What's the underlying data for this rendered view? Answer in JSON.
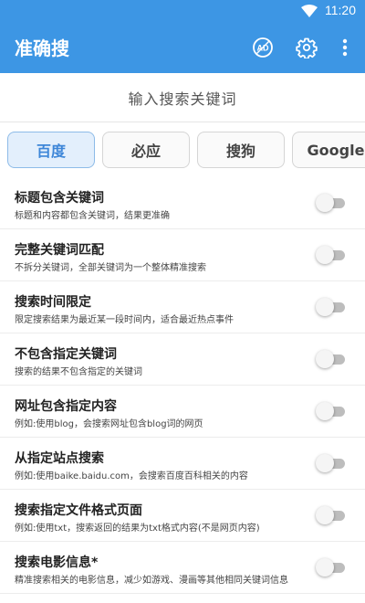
{
  "status_bar": {
    "time": "11:20"
  },
  "app_bar": {
    "title": "准确搜",
    "ad_label": "AD"
  },
  "search": {
    "placeholder": "输入搜索关键词"
  },
  "engines": [
    {
      "label": "百度",
      "active": true
    },
    {
      "label": "必应",
      "active": false
    },
    {
      "label": "搜狗",
      "active": false
    },
    {
      "label": "Google",
      "active": false
    }
  ],
  "options": [
    {
      "title": "标题包含关键词",
      "desc": "标题和内容都包含关键词，结果更准确",
      "enabled": false
    },
    {
      "title": "完整关键词匹配",
      "desc": "不拆分关键词，全部关键词为一个整体精准搜索",
      "enabled": false
    },
    {
      "title": "搜索时间限定",
      "desc": "限定搜索结果为最近某一段时间内，适合最近热点事件",
      "enabled": false
    },
    {
      "title": "不包含指定关键词",
      "desc": "搜索的结果不包含指定的关键词",
      "enabled": false
    },
    {
      "title": "网址包含指定内容",
      "desc": "例如:使用blog，会搜索网址包含blog词的网页",
      "enabled": false
    },
    {
      "title": "从指定站点搜索",
      "desc": "例如:使用baike.baidu.com，会搜索百度百科相关的内容",
      "enabled": false
    },
    {
      "title": "搜索指定文件格式页面",
      "desc": "例如:使用txt，搜索返回的结果为txt格式内容(不是网页内容)",
      "enabled": false
    },
    {
      "title": "搜索电影信息*",
      "desc": "精准搜索相关的电影信息，减少如游戏、漫画等其他相同关键词信息",
      "enabled": false
    }
  ],
  "colors": {
    "primary": "#3d96e4",
    "active_engine_bg": "#e3effc",
    "active_engine_text": "#3d86d8"
  }
}
